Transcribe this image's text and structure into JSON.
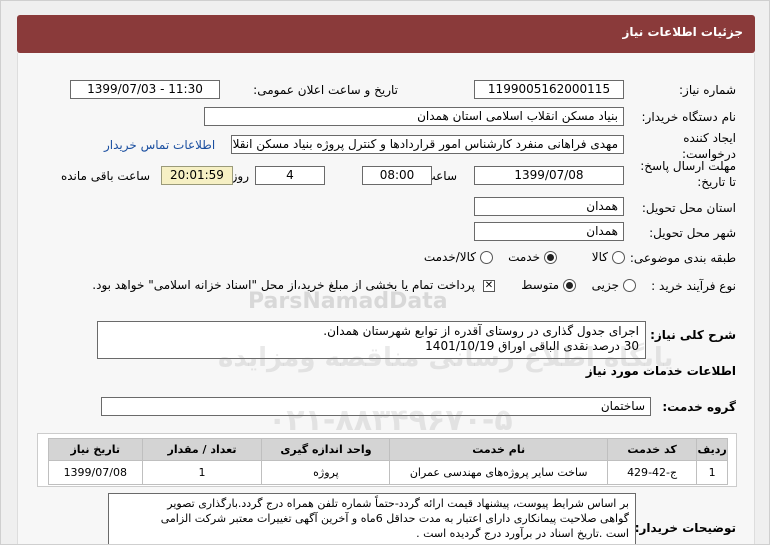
{
  "header": {
    "title": "جزئیات اطلاعات نیاز"
  },
  "fields": {
    "need_number_label": "شماره نیاز:",
    "need_number": "1199005162000115",
    "announce_label": "تاریخ و ساعت اعلان عمومی:",
    "announce_value": "1399/07/03 - 11:30",
    "buyer_label": "نام دستگاه خریدار:",
    "buyer_value": "بنیاد مسکن انقلاب اسلامی استان همدان",
    "creator_label_line1": "ایجاد کننده",
    "creator_label_line2": "درخواست:",
    "creator_value": "مهدی فراهانی منفرد کارشناس امور قراردادها و کنترل پروژه بنیاد مسکن انقلاب",
    "contact_link": "اطلاعات تماس خریدار",
    "deadline_label_line1": "مهلت ارسال پاسخ:",
    "deadline_label_line2": "تا تاریخ:",
    "deadline_date": "1399/07/08",
    "time_label": "ساعت",
    "deadline_time": "08:00",
    "days_value": "4",
    "days_label": "روز و",
    "remaining_time": "20:01:59",
    "remaining_label": "ساعت باقی مانده",
    "province_label": "استان محل تحویل:",
    "province_value": "همدان",
    "city_label": "شهر محل تحویل:",
    "city_value": "همدان",
    "category_label": "طبقه بندی موضوعی:",
    "category_options": [
      "کالا",
      "خدمت",
      "کالا/خدمت"
    ],
    "process_label": "نوع فرآیند خرید :",
    "process_options": [
      "جزیی",
      "متوسط"
    ],
    "payment_note": "پرداخت تمام یا بخشی از مبلغ خرید،از محل \"اسناد خزانه اسلامی\" خواهد بود."
  },
  "summary": {
    "label": "شرح کلی نیاز:",
    "line1": "اجرای جدول گذاری در روستای آقدره از توابع شهرستان همدان.",
    "line2": "30 درصد نقدی الباقی اوراق 1401/10/19"
  },
  "services_section": "اطلاعات خدمات مورد نیاز",
  "service_group": {
    "label": "گروه خدمت:",
    "value": "ساختمان"
  },
  "table": {
    "headers": [
      "ردیف",
      "کد خدمت",
      "نام خدمت",
      "واحد اندازه گیری",
      "تعداد / مقدار",
      "تاریخ نیاز"
    ],
    "rows": [
      [
        "1",
        "ج-42-429",
        "ساخت سایر پروژه‌های مهندسی عمران",
        "پروژه",
        "1",
        "1399/07/08"
      ]
    ]
  },
  "buyer_notes": {
    "label": "توضیحات خریدار:",
    "line1": "بر اساس شرایط پیوست، پیشنهاد قیمت ارائه گردد-حتماً شماره تلفن همراه درج گردد.بارگذاری تصویر",
    "line2": "گواهی صلاحیت پیمانکاری دارای اعتبار به مدت حداقل 6ماه و آخرین آگهی تغییرات معتبر شرکت الزامی",
    "line3": "است .تاریخ اسناد در برآورد درج گردیده است ."
  },
  "watermark": {
    "latin": "ParsNamadData",
    "line1": "پایگاه اطلاع رسانی مناقصه ومزایده",
    "line2": "۰۲۱-۸۸۳۴۹۶۷۰-۵"
  }
}
